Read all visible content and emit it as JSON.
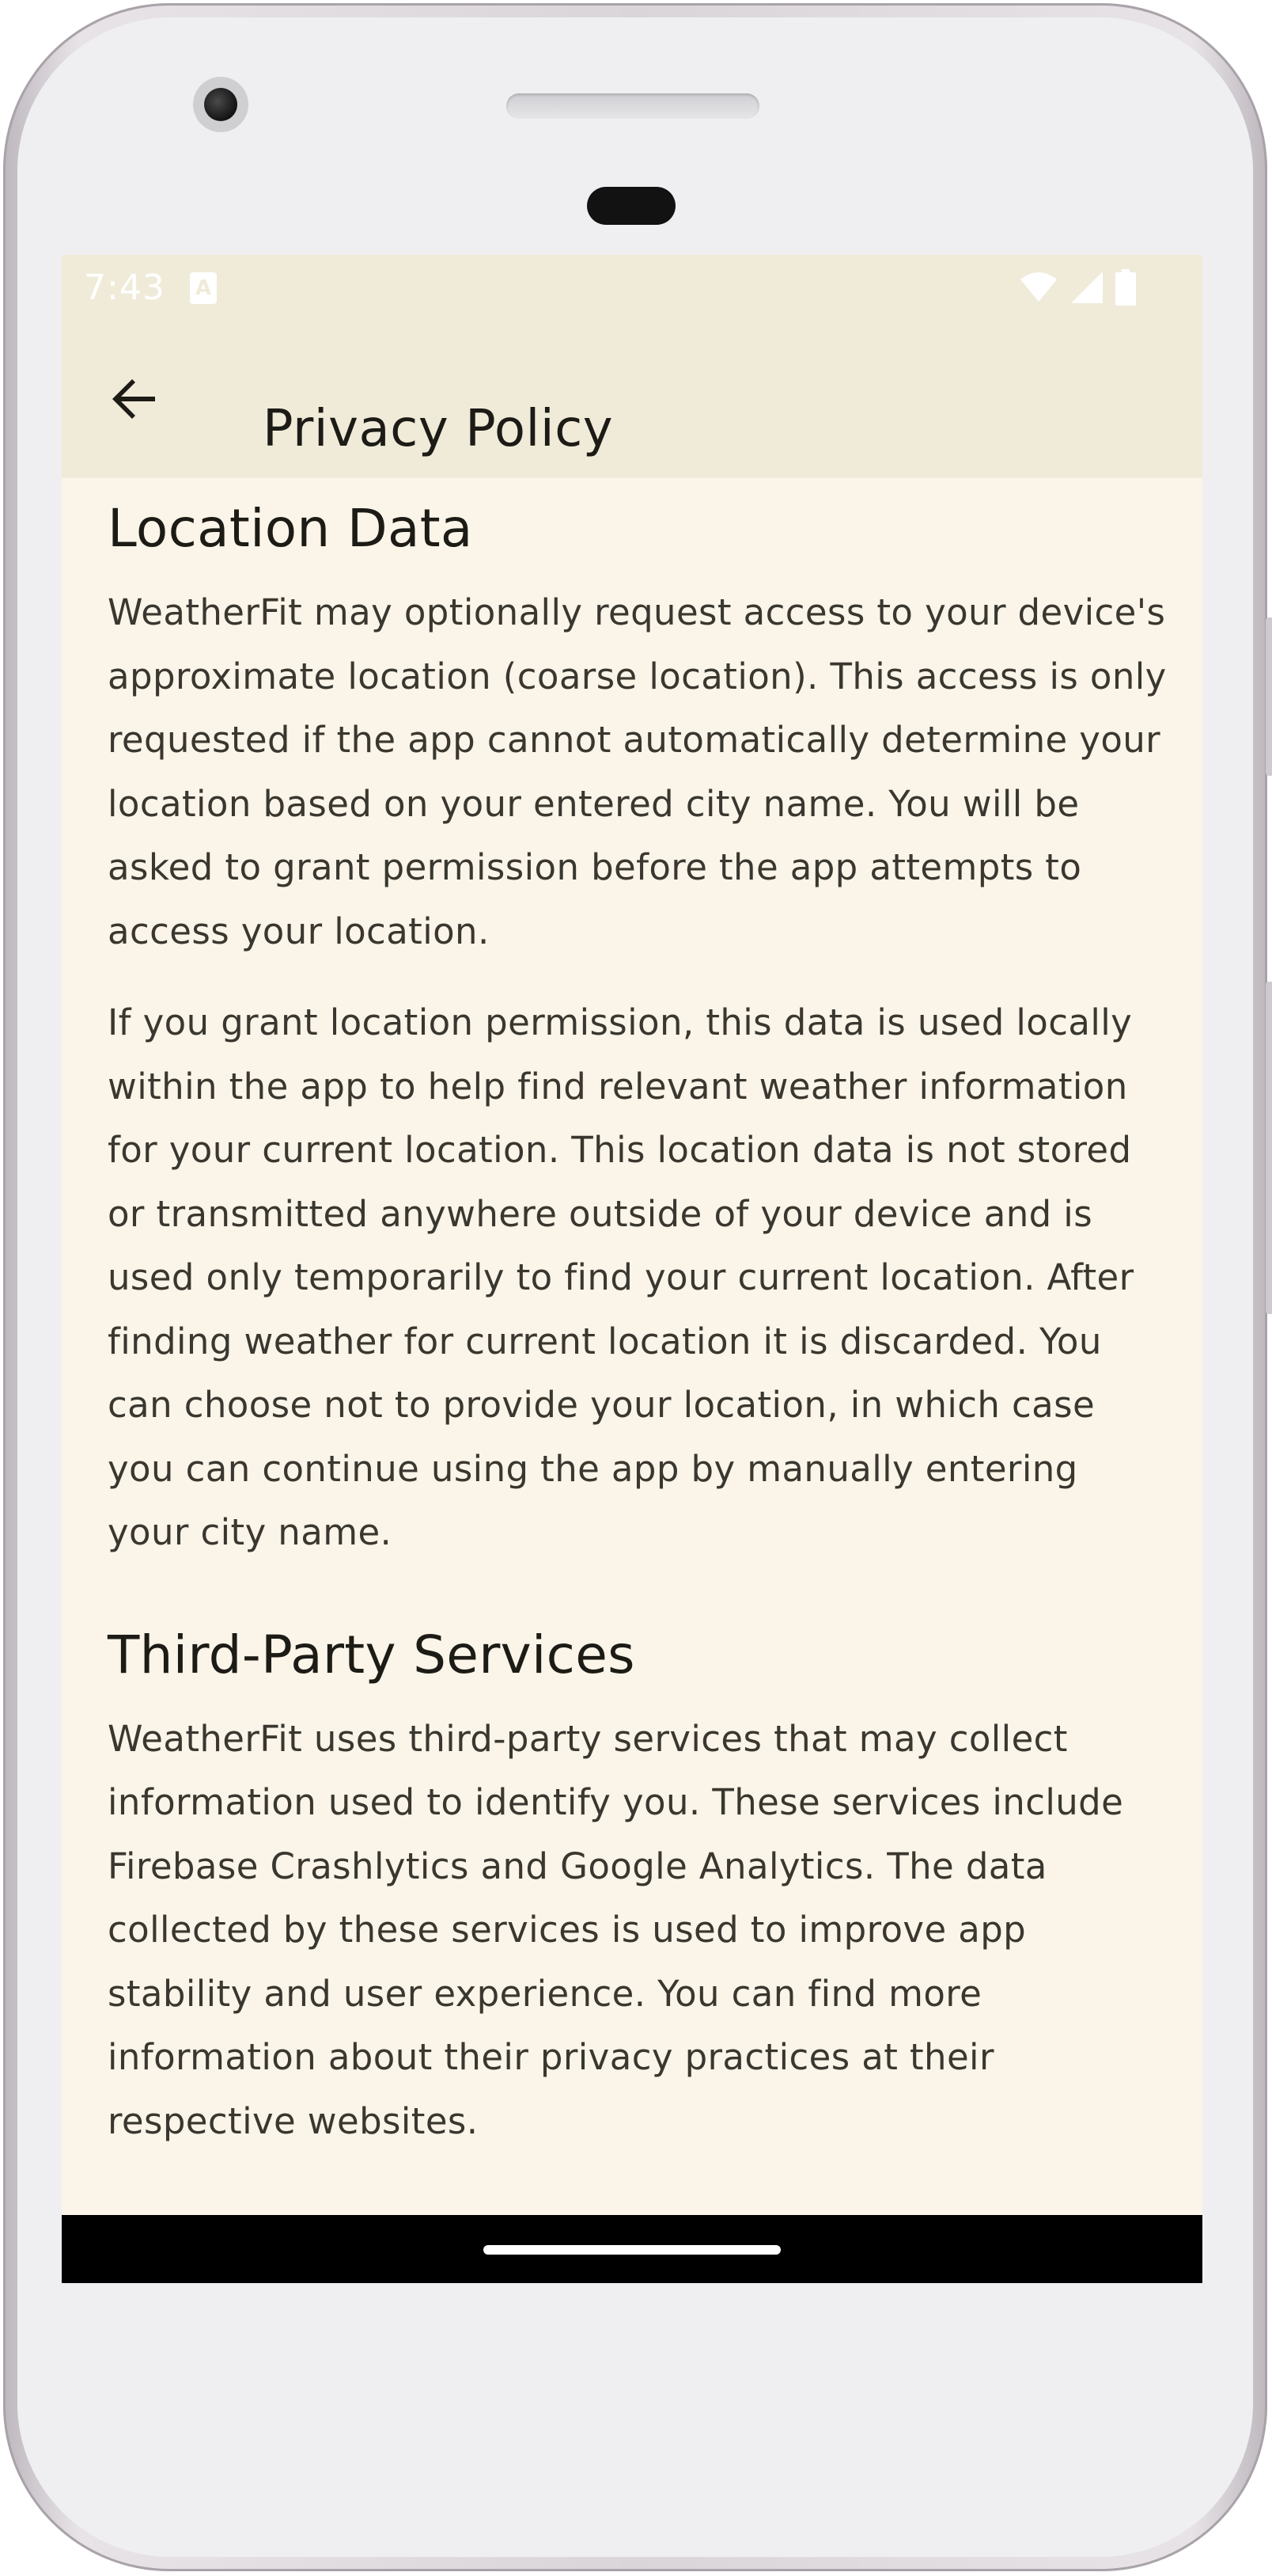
{
  "status_bar": {
    "time": "7:43",
    "notification_icon": "A",
    "icons": [
      "wifi-icon",
      "signal-icon",
      "battery-icon"
    ]
  },
  "app_bar": {
    "back_icon": "arrow-back-icon",
    "title": "Privacy Policy"
  },
  "sections": [
    {
      "heading": "Location Data",
      "paragraphs": [
        "WeatherFit may optionally request access to your device's approximate location (coarse location). This access is only requested if the app cannot automatically determine your location based on your entered city name. You will be asked to grant permission before the app attempts to access your location.",
        "If you grant location permission, this data is used locally within the app to help find relevant weather information for your current location. This location data is not stored or transmitted anywhere outside of your device and is used only temporarily to find your current location. After finding weather for current location it is discarded. You can choose not to provide your location, in which case you can continue using the app by manually entering your city name."
      ]
    },
    {
      "heading": "Third-Party Services",
      "paragraphs": [
        "WeatherFit uses third-party services that may collect information used to identify you. These services include Firebase Crashlytics and Google Analytics. The data collected by these services is used to improve app stability and user experience. You can find more information about their privacy practices at their respective websites."
      ]
    }
  ],
  "colors": {
    "screen_background": "#faf5e8",
    "app_bar_background": "#f0ebd9",
    "heading_text": "#1d1b16",
    "body_text": "#3a3730",
    "nav_bar": "#000000"
  }
}
